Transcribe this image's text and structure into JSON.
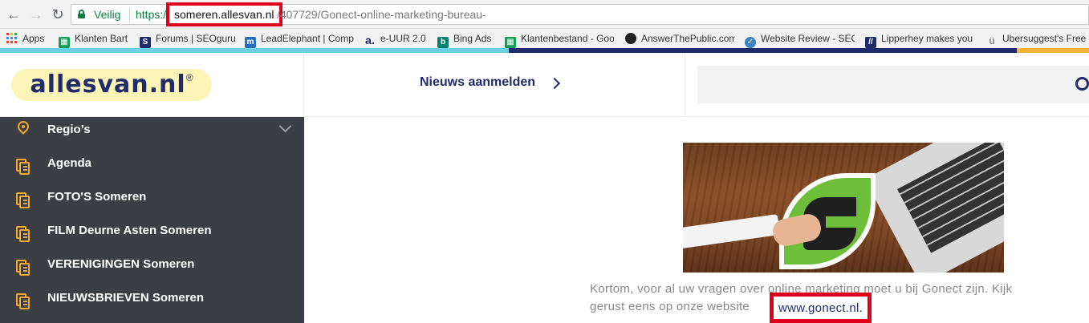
{
  "browser": {
    "secure_label": "Veilig",
    "url_scheme": "https://",
    "url_host": "someren.allesvan.nl",
    "url_path": "/407729/Gonect-online-marketing-bureau-",
    "icons": {
      "back": "back-arrow-icon",
      "forward": "forward-arrow-icon",
      "reload": "reload-icon",
      "lock": "lock-icon"
    },
    "bookmarks": [
      {
        "label": "Apps",
        "icon": "apps-grid-icon",
        "color": "#e94235"
      },
      {
        "label": "Klanten Bart",
        "icon": "sheets-icon",
        "color": "#0f9d58"
      },
      {
        "label": "Forums | SEOguru",
        "icon": "seoguru-icon",
        "color": "#1f2b6b"
      },
      {
        "label": "LeadElephant | Comp",
        "icon": "leadelephant-icon",
        "color": "#2a6ebb"
      },
      {
        "label": "e-UUR 2.0",
        "icon": "euur-icon",
        "color": "#1f2b6b"
      },
      {
        "label": "Bing Ads",
        "icon": "bing-icon",
        "color": "#008272"
      },
      {
        "label": "Klantenbestand - Goo",
        "icon": "sheets-icon",
        "color": "#0f9d58"
      },
      {
        "label": "AnswerThePublic.com",
        "icon": "answerthepublic-icon",
        "color": "#222222"
      },
      {
        "label": "Website Review - SEO",
        "icon": "website-review-icon",
        "color": "#3b82c4"
      },
      {
        "label": "Lipperhey makes you",
        "icon": "lipperhey-icon",
        "color": "#1f2b6b"
      },
      {
        "label": "Ubersuggest's Free",
        "icon": "ubersuggest-icon",
        "color": "#888888"
      }
    ]
  },
  "colors": {
    "navy": "#1f2b6b",
    "cyan": "#6dd0e0",
    "orange": "#f3b23a",
    "sidebar_bg": "#3b3e42",
    "highlight_red": "#e0001b"
  },
  "header": {
    "logo_text": "allesvan.nl",
    "logo_reg": "®",
    "news_label": "Nieuws aanmelden",
    "search_icon": "search-icon"
  },
  "sidebar": {
    "items": [
      {
        "label": "Regio’s",
        "icon": "location-pin-icon"
      },
      {
        "label": "Agenda",
        "icon": "document-icon"
      },
      {
        "label": "FOTO'S Someren",
        "icon": "document-icon"
      },
      {
        "label": "FILM Deurne Asten Someren",
        "icon": "document-icon"
      },
      {
        "label": "VERENIGINGEN Someren",
        "icon": "document-icon"
      },
      {
        "label": "NIEUWSBRIEVEN Someren",
        "icon": "document-icon"
      }
    ]
  },
  "article": {
    "caption_line1": "Kortom, voor al uw vragen over online marketing moet u bij Gonect zijn. Kijk",
    "caption_line2": "gerust eens op onze website",
    "link_text": "www.gonect.nl."
  }
}
